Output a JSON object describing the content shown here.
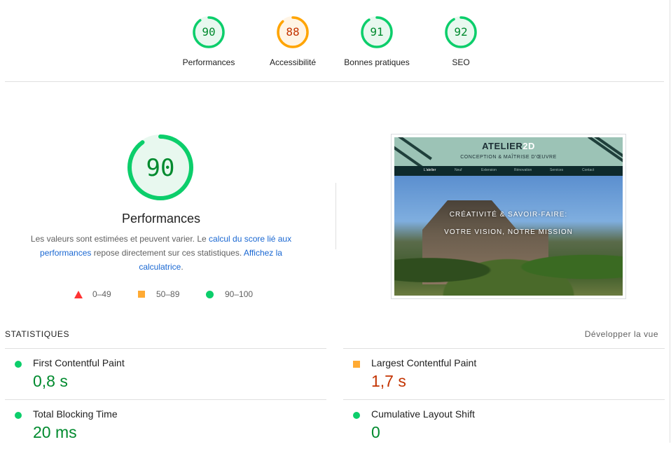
{
  "summary": {
    "gauges": [
      {
        "score": "90",
        "label": "Performances",
        "color": "#0cce6b",
        "text_color": "#008a2e",
        "fill": "#e8f8ef",
        "fraction": 0.9
      },
      {
        "score": "88",
        "label": "Accessibilité",
        "color": "#ffa400",
        "text_color": "#c33300",
        "fill": "#fff4e5",
        "fraction": 0.88
      },
      {
        "score": "91",
        "label": "Bonnes pratiques",
        "color": "#0cce6b",
        "text_color": "#008a2e",
        "fill": "#e8f8ef",
        "fraction": 0.91
      },
      {
        "score": "92",
        "label": "SEO",
        "color": "#0cce6b",
        "text_color": "#008a2e",
        "fill": "#e8f8ef",
        "fraction": 0.92
      }
    ]
  },
  "performance": {
    "score": "90",
    "fraction": 0.9,
    "title": "Performances",
    "desc_part1": "Les valeurs sont estimées et peuvent varier. Le ",
    "desc_link1": "calcul du score lié aux performances",
    "desc_part2": " repose directement sur ces statistiques. ",
    "desc_link2": "Affichez la calculatrice",
    "desc_part3": ".",
    "legend": {
      "fail": "0–49",
      "average": "50–89",
      "pass": "90–100"
    }
  },
  "screenshot": {
    "logo_main": "ATELIER",
    "logo_accent": "2D",
    "tagline": "CONCEPTION & MAÎTRISE D'ŒUVRE",
    "nav": [
      "L'atelier",
      "Neuf",
      "Extension",
      "Rénovation",
      "Services",
      "Contact"
    ],
    "hero_line1": "CRÉATIVITÉ & SAVOIR-FAIRE:",
    "hero_line2": "VOTRE VISION, NOTRE MISSION"
  },
  "metrics": {
    "heading": "STATISTIQUES",
    "toggle_label": "Développer la vue",
    "items": [
      {
        "title": "First Contentful Paint",
        "value": "0,8 s",
        "rating": "pass"
      },
      {
        "title": "Largest Contentful Paint",
        "value": "1,7 s",
        "rating": "average"
      },
      {
        "title": "Total Blocking Time",
        "value": "20 ms",
        "rating": "pass"
      },
      {
        "title": "Cumulative Layout Shift",
        "value": "0",
        "rating": "pass"
      }
    ]
  },
  "colors": {
    "pass": "#0cce6b",
    "average": "#ffa400",
    "fail": "#ff3333",
    "link": "#1967d2"
  }
}
